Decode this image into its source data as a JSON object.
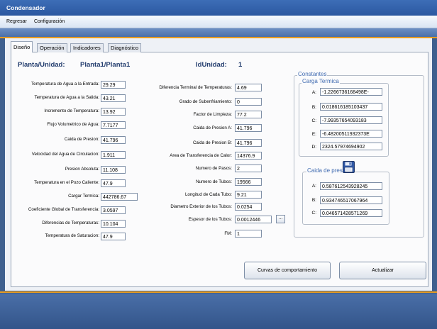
{
  "window": {
    "title": "Condensador"
  },
  "menu": {
    "items": [
      "Regresar",
      "Configuración"
    ]
  },
  "tabs": [
    "Diseño",
    "Operación",
    "Indicadores",
    "Diagnóstico"
  ],
  "header": {
    "planta_label": "Planta/Unidad:",
    "planta_value": "Planta1/Planta1",
    "id_label": "IdUnidad:",
    "id_value": "1"
  },
  "left_fields": [
    {
      "label": "Temperatura de Agua  a  la Entrada:",
      "value": "29.29"
    },
    {
      "label": "Temperatura de Agua  a  la Salida:",
      "value": "43.21"
    },
    {
      "label": "Incremento de Temperatura:",
      "value": "13.92"
    },
    {
      "label": "Flujo Volumetrico de Agua:",
      "value": "7.7177"
    },
    {
      "label": "Caida de Presion:",
      "value": "41.796"
    },
    {
      "label": "Velocidad del Agua de Circulacion:",
      "value": "1.911"
    },
    {
      "label": "Presion Absoluta:",
      "value": "11.108"
    },
    {
      "label": "Temperatura en el Pozo Caliente:",
      "value": "47.9"
    },
    {
      "label": "Cargar Termica:",
      "value": "442786.67"
    },
    {
      "label": "Coeficiente Global de Transferencia:",
      "value": "3.0597"
    },
    {
      "label": "Diferencias de Temperaturas:",
      "value": "10.104"
    },
    {
      "label": "Temperatura de Saturacion:",
      "value": "47.9"
    }
  ],
  "middle_fields": [
    {
      "label": "Diferencia Terminal de Temperaturas:",
      "value": "4.69"
    },
    {
      "label": "Grado de Subenfriamiento:",
      "value": "0"
    },
    {
      "label": "Factor de Limpieza:",
      "value": "77.2"
    },
    {
      "label": "Caida de Presion A:",
      "value": "41.796"
    },
    {
      "label": "Caida de Presion B:",
      "value": "41.796"
    },
    {
      "label": "Area de Transferencia de Calor:",
      "value": "14376.9"
    },
    {
      "label": "Numero de Pasos:",
      "value": "2"
    },
    {
      "label": "Numero de Tubos:",
      "value": "19566"
    },
    {
      "label": "Longitud de Cada Tubo:",
      "value": "9.21"
    },
    {
      "label": "Diametro Exterior de los Tubos:",
      "value": "0.0254"
    },
    {
      "label": "Espesor de los Tubos:",
      "value": "0.0012446"
    },
    {
      "label": "FM:",
      "value": "1"
    }
  ],
  "espesor_button": "...",
  "constantes": {
    "title": "Constantes",
    "carga": {
      "title": "Carga Termica",
      "items": [
        {
          "key": "A:",
          "value": "-1.2266736168498E-"
        },
        {
          "key": "B:",
          "value": "0.018616185103437"
        },
        {
          "key": "C:",
          "value": "-7.99357654093183"
        },
        {
          "key": "E:",
          "value": "-6.48200511932373E"
        },
        {
          "key": "D:",
          "value": "2324.57974694902"
        }
      ]
    },
    "caida": {
      "title": "Caida de presión",
      "items": [
        {
          "key": "A:",
          "value": "0.587612543928245"
        },
        {
          "key": "B:",
          "value": "0.934746517067964"
        },
        {
          "key": "C:",
          "value": "0.046571428571269"
        }
      ]
    }
  },
  "buttons": {
    "curvas": "Curvas de comportamiento",
    "actualizar": "Actualizar"
  },
  "icons": {
    "save": "floppy-disk-icon"
  }
}
